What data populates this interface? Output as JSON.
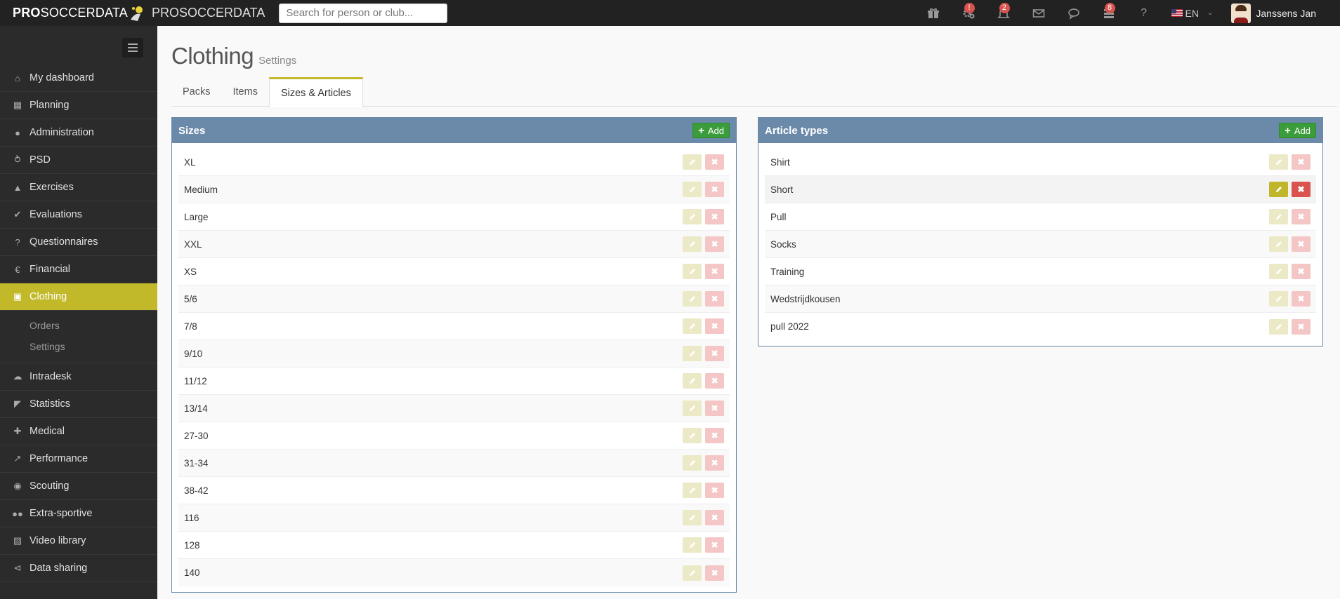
{
  "topbar": {
    "brand_bold": "PRO",
    "brand_rest": "SOCCERDATA",
    "club_name": "PROSOCCERDATA",
    "search_placeholder": "Search for person or club...",
    "badges": {
      "settings": "!",
      "alerts": "2",
      "tasks": "8"
    },
    "help": "?",
    "language": "EN",
    "user_name": "Janssens Jan"
  },
  "sidebar": {
    "items": [
      {
        "label": "My dashboard",
        "icon": "home-icon"
      },
      {
        "label": "Planning",
        "icon": "calendar-icon"
      },
      {
        "label": "Administration",
        "icon": "user-icon"
      },
      {
        "label": "PSD",
        "icon": "psd-icon"
      },
      {
        "label": "Exercises",
        "icon": "exercise-icon"
      },
      {
        "label": "Evaluations",
        "icon": "check-icon"
      },
      {
        "label": "Questionnaires",
        "icon": "question-icon"
      },
      {
        "label": "Financial",
        "icon": "euro-icon"
      },
      {
        "label": "Clothing",
        "icon": "cart-icon",
        "active": true
      },
      {
        "label": "Intradesk",
        "icon": "cloud-icon"
      },
      {
        "label": "Statistics",
        "icon": "area-chart-icon"
      },
      {
        "label": "Medical",
        "icon": "medkit-icon"
      },
      {
        "label": "Performance",
        "icon": "line-chart-icon"
      },
      {
        "label": "Scouting",
        "icon": "globe-icon"
      },
      {
        "label": "Extra-sportive",
        "icon": "users-icon"
      },
      {
        "label": "Video library",
        "icon": "film-icon"
      },
      {
        "label": "Data sharing",
        "icon": "share-icon"
      }
    ],
    "clothing_sub": [
      "Orders",
      "Settings"
    ]
  },
  "page": {
    "title": "Clothing",
    "subtitle": "Settings",
    "tabs": [
      "Packs",
      "Items",
      "Sizes & Articles"
    ],
    "active_tab": 2
  },
  "sizes_panel": {
    "title": "Sizes",
    "add_label": "Add",
    "rows": [
      "XL",
      "Medium",
      "Large",
      "XXL",
      "XS",
      "5/6",
      "7/8",
      "9/10",
      "11/12",
      "13/14",
      "27-30",
      "31-34",
      "38-42",
      "116",
      "128",
      "140"
    ]
  },
  "articles_panel": {
    "title": "Article types",
    "add_label": "Add",
    "rows": [
      "Shirt",
      "Short",
      "Pull",
      "Socks",
      "Training",
      "Wedstrijdkousen",
      "pull 2022"
    ],
    "hovered_row": 1
  },
  "colors": {
    "accent": "#c2b92a",
    "panel_header": "#6b8aaa",
    "add_button": "#3b9c3b",
    "delete": "#d9534f"
  }
}
